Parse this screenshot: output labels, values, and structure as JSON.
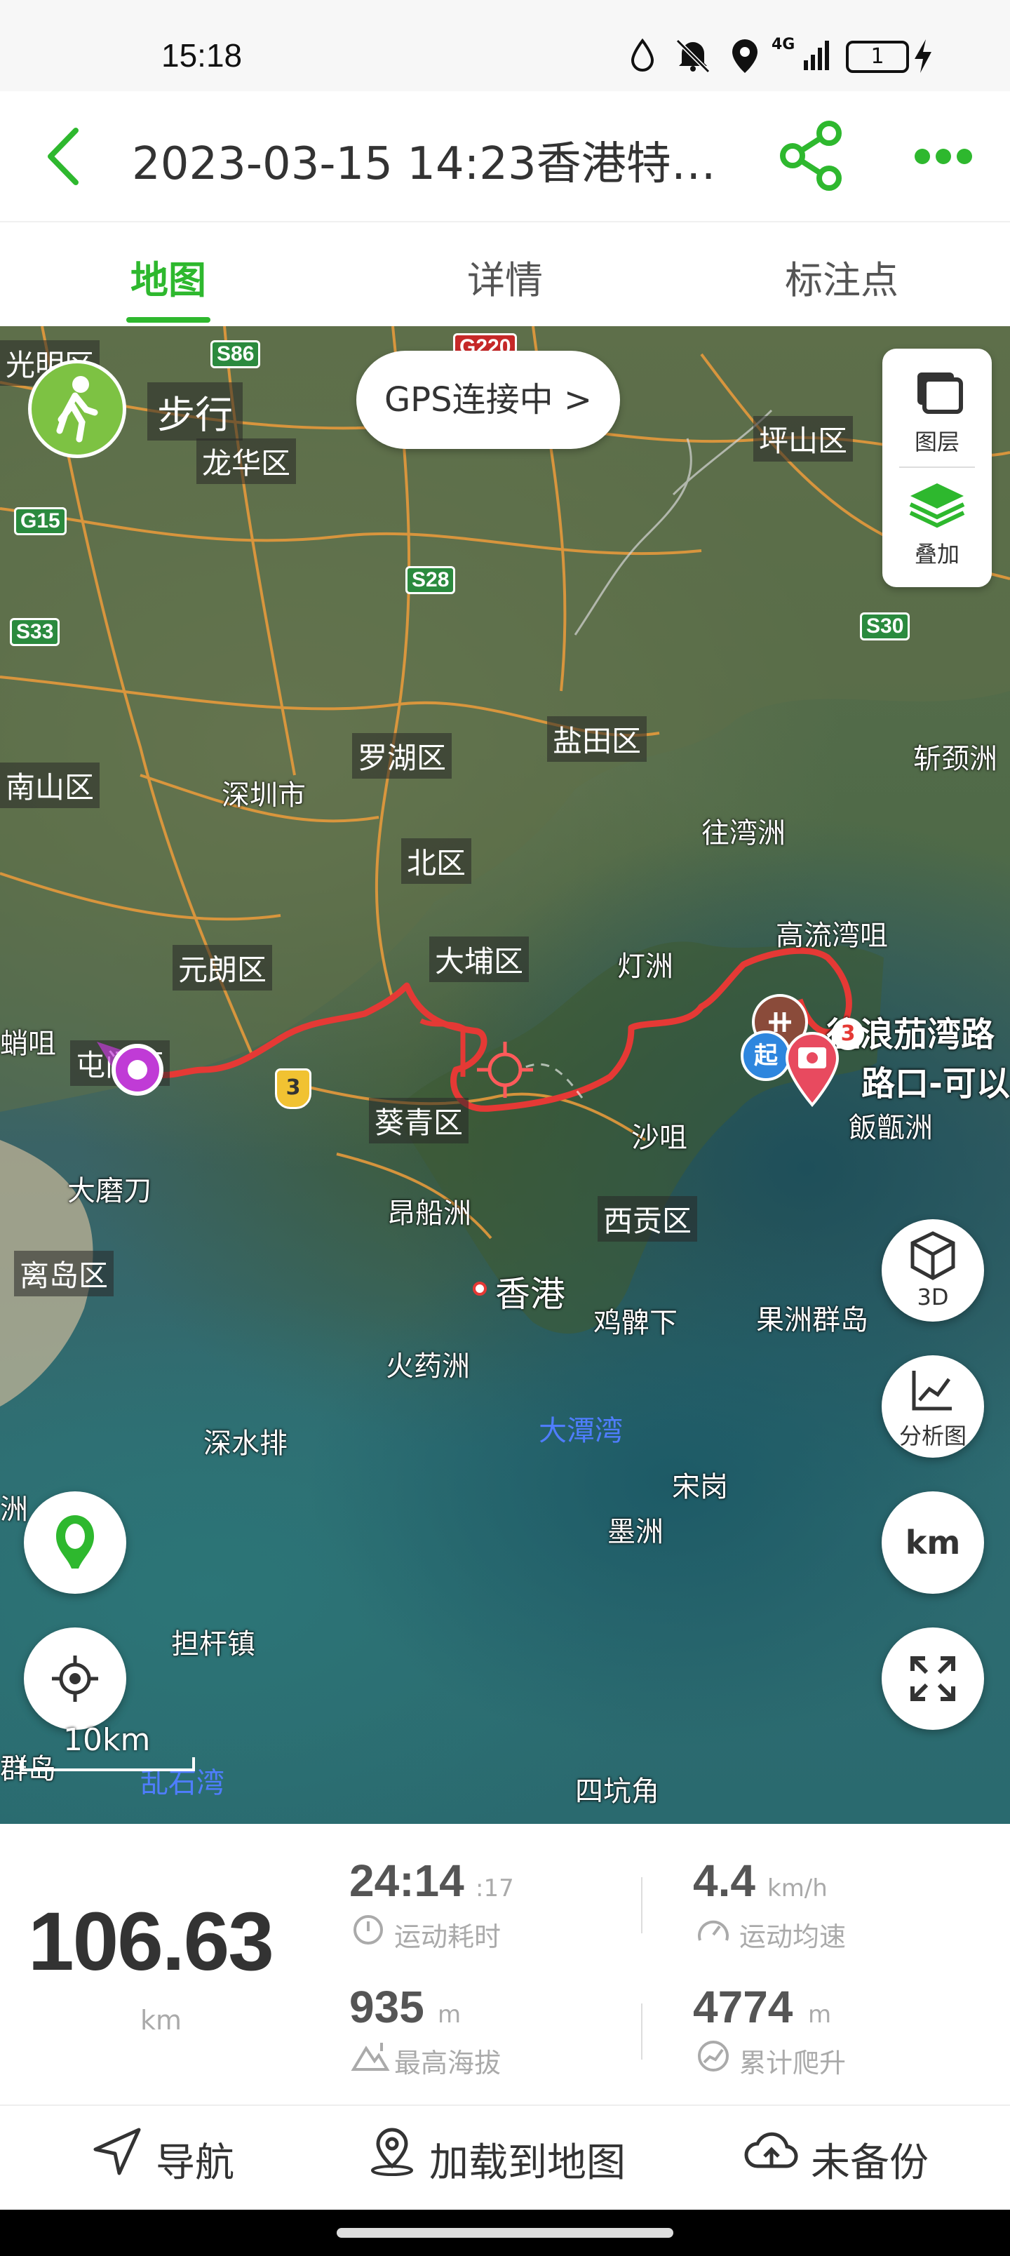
{
  "status_bar": {
    "time": "15:18",
    "network": "4G",
    "battery": "1"
  },
  "header": {
    "back_icon": "chevron-left-icon",
    "title": "2023-03-15 14:23香港特…",
    "share_icon": "share-icon",
    "more_icon": "more-dots-icon"
  },
  "tabs": [
    {
      "label": "地图",
      "active": true
    },
    {
      "label": "详情",
      "active": false
    },
    {
      "label": "标注点",
      "active": false
    }
  ],
  "map": {
    "mode_label": "步行",
    "gps_label": "GPS连接中 >",
    "layer_label": "图层",
    "overlay_label": "叠加",
    "btn_3d": "3D",
    "btn_analysis": "分析图",
    "btn_km": "km",
    "scale": "10km",
    "places": [
      "光明区",
      "龙华区",
      "坪山区",
      "罗湖区",
      "盐田区",
      "南山区",
      "深圳市",
      "北区",
      "往湾洲",
      "斩颈洲",
      "元朗区",
      "大埔区",
      "灯洲",
      "高流湾咀",
      "屯门区",
      "葵青区",
      "沙咀",
      "大磨刀",
      "昂船洲",
      "西贡区",
      "离岛区",
      "香港",
      "鸡髀下",
      "果洲群岛",
      "火药洲",
      "大潭湾",
      "深水排",
      "宋岗",
      "墨洲",
      "担杆镇",
      "四坑角",
      "乱石湾",
      "群岛",
      "洲",
      "蛸咀",
      "飯甑洲"
    ],
    "poi_label_1": "往浪茄湾路",
    "poi_label_2": "路口-可以",
    "highways": [
      "S86",
      "G220",
      "G15",
      "S28",
      "S33",
      "S30",
      "3"
    ],
    "route_color": "#e53935",
    "accent_color": "#2eb82e"
  },
  "stats": {
    "distance": "106.63",
    "distance_unit": "km",
    "duration": "24:14",
    "duration_sec": ":17",
    "duration_label": "运动耗时",
    "avg_speed": "4.4",
    "avg_speed_unit": "km/h",
    "avg_speed_label": "运动均速",
    "max_alt": "935",
    "max_alt_unit": "m",
    "max_alt_label": "最高海拔",
    "climb": "4774",
    "climb_unit": "m",
    "climb_label": "累计爬升"
  },
  "bottom": {
    "navigate": "导航",
    "load_to_map": "加载到地图",
    "backup": "未备份"
  }
}
